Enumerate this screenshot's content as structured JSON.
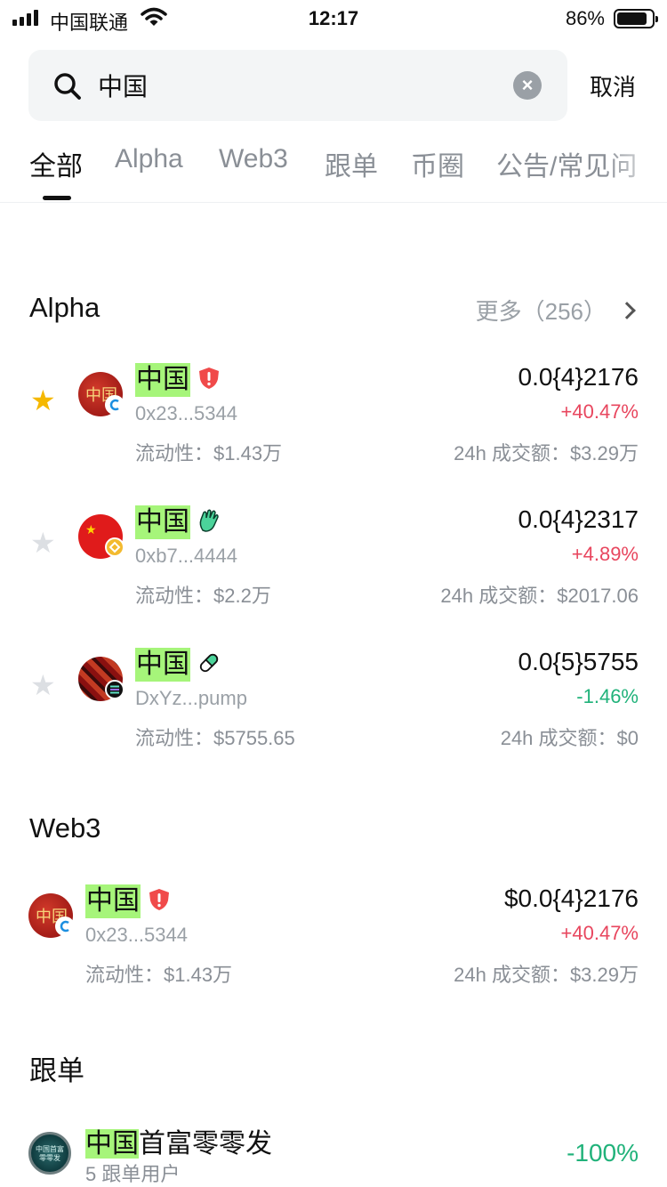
{
  "status": {
    "carrier": "中国联通",
    "time": "12:17",
    "battery": "86%",
    "battery_level": 0.86
  },
  "search": {
    "query": "中国",
    "cancel_label": "取消"
  },
  "tabs": [
    {
      "label": "全部",
      "active": true
    },
    {
      "label": "Alpha",
      "active": false
    },
    {
      "label": "Web3",
      "active": false
    },
    {
      "label": "跟单",
      "active": false
    },
    {
      "label": "币圈",
      "active": false
    },
    {
      "label": "公告/常见问",
      "active": false
    }
  ],
  "alpha": {
    "title": "Alpha",
    "more_label": "更多（256）",
    "items": [
      {
        "name": "中国",
        "tag_icon": "warning-shield-icon",
        "address": "0x23...5344",
        "liquidity": "流动性：$1.43万",
        "price": "0.0{4}2176",
        "change": "+40.47%",
        "volume": "24h 成交额：$3.29万",
        "starred": true
      },
      {
        "name": "中国",
        "tag_icon": "hand-wave-icon",
        "address": "0xb7...4444",
        "liquidity": "流动性：$2.2万",
        "price": "0.0{4}2317",
        "change": "+4.89%",
        "volume": "24h 成交额：$2017.06",
        "starred": false
      },
      {
        "name": "中国",
        "tag_icon": "pill-icon",
        "address": "DxYz...pump",
        "liquidity": "流动性：$5755.65",
        "price": "0.0{5}5755",
        "change": "-1.46%",
        "volume": "24h 成交额：$0",
        "starred": false
      }
    ]
  },
  "web3": {
    "title": "Web3",
    "items": [
      {
        "name": "中国",
        "tag_icon": "warning-shield-icon",
        "address": "0x23...5344",
        "liquidity": "流动性：$1.43万",
        "price": "$0.0{4}2176",
        "change": "+40.47%",
        "volume": "24h 成交额：$3.29万"
      }
    ]
  },
  "copy_trading": {
    "title": "跟单",
    "items": [
      {
        "name_highlight": "中国",
        "name_rest": "首富零零发",
        "users": "5 跟单用户",
        "change": "-100%",
        "avatar_text": "中国首富 零零发"
      }
    ]
  },
  "colors": {
    "highlight": "#a6f57a",
    "up": "#e8465e",
    "down": "#20b27a",
    "star_active": "#f5b800",
    "star_inactive": "#dcdfe3"
  }
}
